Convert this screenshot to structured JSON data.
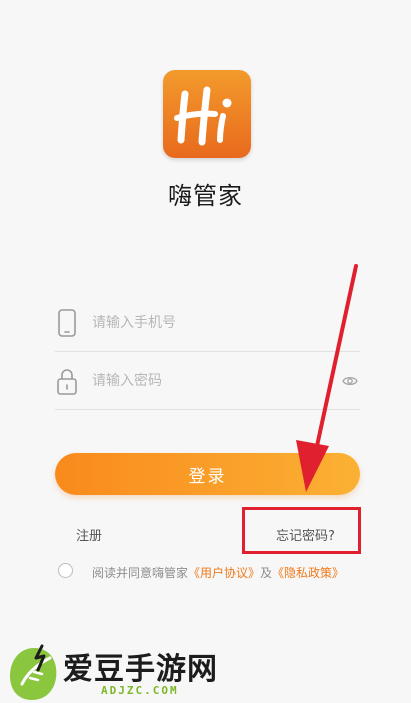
{
  "app": {
    "logo_text": "Hi",
    "name": "嗨管家",
    "brand_color": "#ee7a22"
  },
  "form": {
    "phone": {
      "placeholder": "请输入手机号",
      "icon": "phone-icon"
    },
    "password": {
      "placeholder": "请输入密码",
      "icon": "lock-icon",
      "toggle_icon": "eye-icon"
    },
    "login_label": "登录"
  },
  "links": {
    "register": "注册",
    "forgot_password": "忘记密码?"
  },
  "agreement": {
    "prefix": "阅读并同意嗨管家",
    "user_agreement": "《用户协议》",
    "conjunction": "及",
    "privacy_policy": "《隐私政策》",
    "checked": false
  },
  "annotation": {
    "color": "#e0202e"
  },
  "watermark": {
    "title": "爱豆手游网",
    "domain": "ADJZC.COM"
  }
}
